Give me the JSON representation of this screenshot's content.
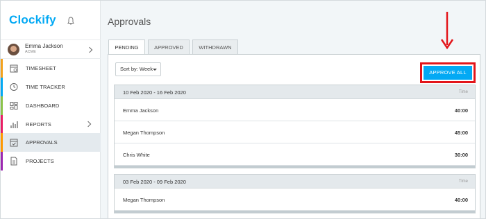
{
  "app": {
    "logo_text": "Clockify",
    "colors": {
      "brand": "#03a9f4",
      "highlight": "#e3151a",
      "active_bg": "#e4eaee"
    }
  },
  "user": {
    "name": "Emma Jackson",
    "org": "ACME"
  },
  "sidebar": {
    "items": [
      {
        "label": "TIMESHEET",
        "icon": "timesheet-icon",
        "stripe": "#f4a21c"
      },
      {
        "label": "TIME TRACKER",
        "icon": "clock-icon",
        "stripe": "#03a9f4"
      },
      {
        "label": "DASHBOARD",
        "icon": "dashboard-icon",
        "stripe": "#8bc34a"
      },
      {
        "label": "REPORTS",
        "icon": "reports-icon",
        "stripe": "#e91e63"
      },
      {
        "label": "APPROVALS",
        "icon": "approvals-icon",
        "stripe": "#ff9800"
      },
      {
        "label": "PROJECTS",
        "icon": "projects-icon",
        "stripe": "#9c27b0"
      }
    ]
  },
  "page": {
    "title": "Approvals"
  },
  "tabs": [
    {
      "label": "PENDING"
    },
    {
      "label": "APPROVED"
    },
    {
      "label": "WITHDRAWN"
    }
  ],
  "toolbar": {
    "sort_label": "Sort by: Week",
    "approve_all_label": "APPROVE ALL"
  },
  "groups": [
    {
      "range": "10 Feb 2020 - 16 Feb 2020",
      "time_header": "Time",
      "rows": [
        {
          "name": "Emma Jackson",
          "total": "40:00"
        },
        {
          "name": "Megan Thompson",
          "total": "45:00"
        },
        {
          "name": "Chris White",
          "total": "30:00"
        }
      ]
    },
    {
      "range": "03 Feb 2020 - 09 Feb 2020",
      "time_header": "Time",
      "rows": [
        {
          "name": "Megan Thompson",
          "total": "40:00"
        }
      ]
    }
  ]
}
